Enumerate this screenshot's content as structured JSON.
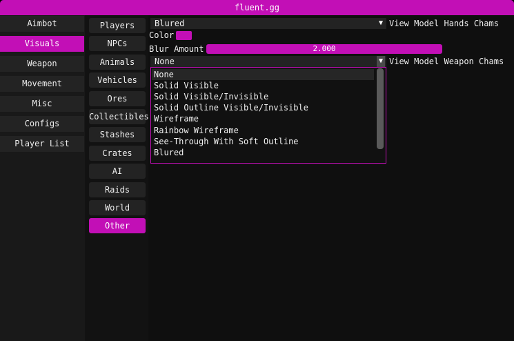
{
  "window": {
    "title": "fluent.gg"
  },
  "nav": [
    {
      "label": "Aimbot",
      "active": false
    },
    {
      "label": "Visuals",
      "active": true
    },
    {
      "label": "Weapon",
      "active": false
    },
    {
      "label": "Movement",
      "active": false
    },
    {
      "label": "Misc",
      "active": false
    },
    {
      "label": "Configs",
      "active": false
    },
    {
      "label": "Player List",
      "active": false
    }
  ],
  "subnav": [
    {
      "label": "Players",
      "active": false
    },
    {
      "label": "NPCs",
      "active": false
    },
    {
      "label": "Animals",
      "active": false
    },
    {
      "label": "Vehicles",
      "active": false
    },
    {
      "label": "Ores",
      "active": false
    },
    {
      "label": "Collectibles",
      "active": false
    },
    {
      "label": "Stashes",
      "active": false
    },
    {
      "label": "Crates",
      "active": false
    },
    {
      "label": "AI",
      "active": false
    },
    {
      "label": "Raids",
      "active": false
    },
    {
      "label": "World",
      "active": false
    },
    {
      "label": "Other",
      "active": true
    }
  ],
  "hands": {
    "value": "Blured",
    "arrow": "▼",
    "label": "View Model Hands Chams"
  },
  "color": {
    "label": "Color",
    "swatch": "#c20fb6"
  },
  "blur": {
    "label": "Blur Amount",
    "value": "2.000"
  },
  "weapon": {
    "value": "None",
    "arrow": "▼",
    "label": "View Model Weapon Chams",
    "options": [
      "None",
      "Solid Visible",
      "Solid Visible/Invisible",
      "Solid Outline Visible/Invisible",
      "Wireframe",
      "Rainbow Wireframe",
      "See-Through With Soft Outline",
      "Blured"
    ],
    "highlighted": 0
  },
  "accent": "#c20fb6"
}
